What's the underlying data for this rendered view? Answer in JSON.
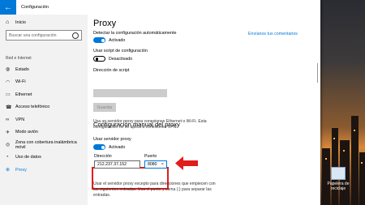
{
  "window": {
    "title": "Configuración",
    "back_icon": "back-arrow-icon"
  },
  "sidebar": {
    "home_label": "Inicio",
    "search_placeholder": "Buscar una configuración",
    "section_label": "Red e Internet",
    "items": [
      {
        "label": "Estado",
        "icon": "globe-icon"
      },
      {
        "label": "Wi-Fi",
        "icon": "wifi-icon"
      },
      {
        "label": "Ethernet",
        "icon": "ethernet-icon"
      },
      {
        "label": "Acceso telefónico",
        "icon": "phone-icon"
      },
      {
        "label": "VPN",
        "icon": "vpn-icon"
      },
      {
        "label": "Modo avión",
        "icon": "airplane-icon"
      },
      {
        "label": "Zona con cobertura inalámbrica móvil",
        "icon": "hotspot-icon"
      },
      {
        "label": "Uso de datos",
        "icon": "data-usage-icon"
      },
      {
        "label": "Proxy",
        "icon": "proxy-icon",
        "active": true
      }
    ]
  },
  "main": {
    "title": "Proxy",
    "comments_link": "Envíanos tus comentarios",
    "auto_detect_label": "Detectar la configuración automáticamente",
    "auto_detect_state": "Activado",
    "use_script_label": "Usar script de configuración",
    "use_script_state": "Desactivado",
    "script_address_label": "Dirección de script",
    "save_button": "Guardar",
    "manual_heading": "Configuración manual del proxy",
    "manual_desc_1": "Usa un servidor proxy para conexiones Ethernet o Wi-Fi. Esta",
    "manual_desc_2": "configuración no se aplica a conexiones VPN.",
    "use_proxy_label": "Usar servidor proxy",
    "use_proxy_state": "Activado",
    "address_label": "Dirección",
    "address_value": "212.237.37.152",
    "port_label": "Puerto",
    "port_value": "8080",
    "exceptions_1": "Usar el servidor proxy excepto para direcciones que empiecen con",
    "exceptions_2": "las siguientes entradas. Usa el punto y coma (;) para separar las",
    "exceptions_3": "entradas."
  },
  "desktop": {
    "icon_label": "Papelera de reciclaje"
  },
  "colors": {
    "accent": "#0078d7",
    "highlight": "#e21b1b"
  }
}
